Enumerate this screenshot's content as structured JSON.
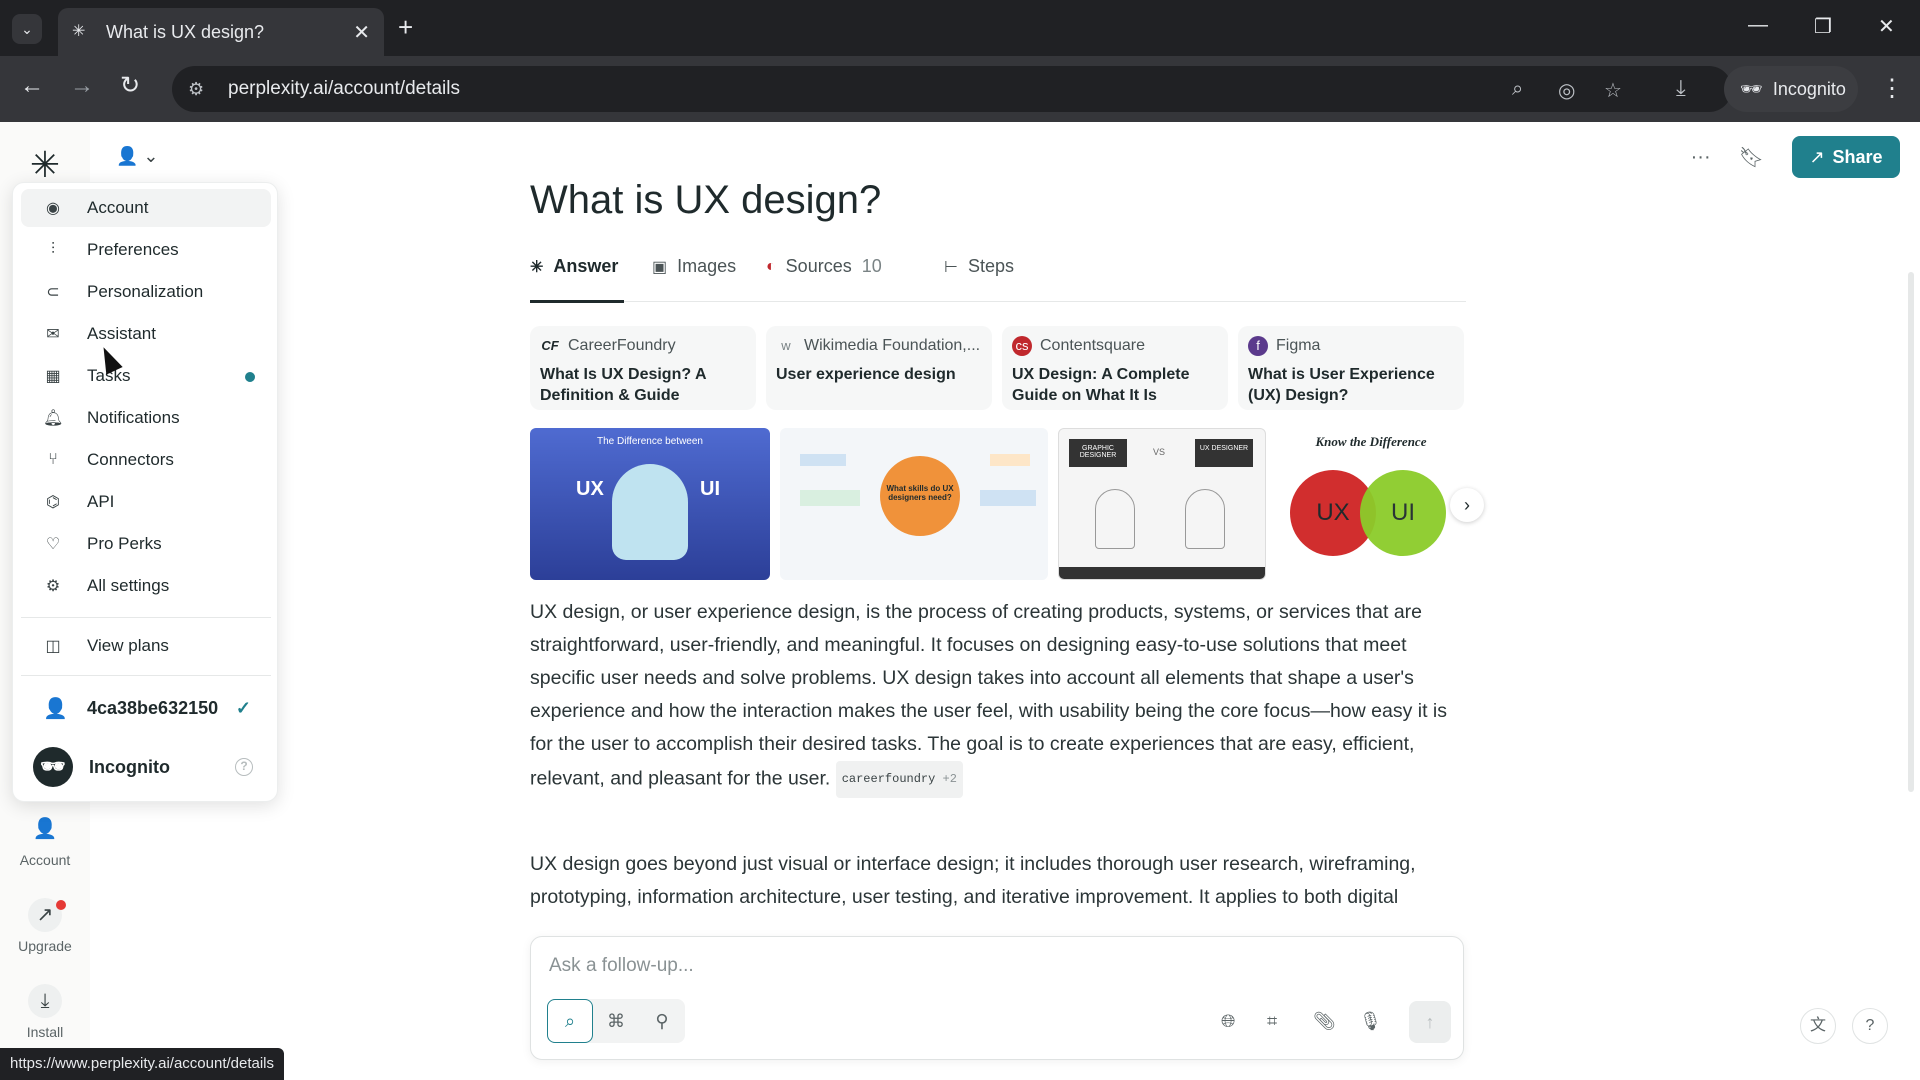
{
  "browser": {
    "tab_title": "What is UX design?",
    "url": "perplexity.ai/account/details",
    "incognito_label": "Incognito",
    "status_url": "https://www.perplexity.ai/account/details"
  },
  "account_menu": {
    "items": [
      {
        "label": "Account",
        "icon": "account-circle-icon"
      },
      {
        "label": "Preferences",
        "icon": "sliders-icon"
      },
      {
        "label": "Personalization",
        "icon": "toggle-icon"
      },
      {
        "label": "Assistant",
        "icon": "mail-icon"
      },
      {
        "label": "Tasks",
        "icon": "calendar-icon"
      },
      {
        "label": "Notifications",
        "icon": "bell-icon"
      },
      {
        "label": "Connectors",
        "icon": "branch-icon"
      },
      {
        "label": "API",
        "icon": "api-icon"
      },
      {
        "label": "Pro Perks",
        "icon": "gift-icon"
      },
      {
        "label": "All settings",
        "icon": "gear-icon"
      }
    ],
    "view_plans": "View plans",
    "user_id": "4ca38be632150",
    "incognito": "Incognito"
  },
  "rail": {
    "account": "Account",
    "upgrade": "Upgrade",
    "install": "Install"
  },
  "header": {
    "share": "Share"
  },
  "thread": {
    "title": "What is UX design?",
    "tabs": {
      "answer": "Answer",
      "images": "Images",
      "sources": "Sources",
      "sources_count": "10",
      "steps": "Steps"
    },
    "sources": [
      {
        "site": "CareerFoundry",
        "title": "What Is UX Design? A Definition & Guide"
      },
      {
        "site": "Wikimedia Foundation,...",
        "title": "User experience design"
      },
      {
        "site": "Contentsquare",
        "title": "UX Design: A Complete Guide on What It Is"
      },
      {
        "site": "Figma",
        "title": "What is User Experience (UX) Design?"
      }
    ],
    "images": [
      {
        "caption": "The Difference between",
        "left": "UX",
        "right": "UI"
      },
      {
        "caption": "What skills do UX designers need?"
      },
      {
        "left": "GRAPHIC DESIGNER",
        "vs": "VS",
        "right": "UX DESIGNER"
      },
      {
        "caption": "Know the Difference",
        "left": "UX",
        "right": "UI"
      }
    ],
    "para1": "UX design, or user experience design, is the process of creating products, systems, or services that are straightforward, user-friendly, and meaningful. It focuses on designing easy-to-use solutions that meet specific user needs and solve problems. UX design takes into account all elements that shape a user's experience and how the interaction makes the user feel, with usability being the core focus—how easy it is for the user to accomplish their desired tasks. The goal is to create experiences that are easy, efficient, relevant, and pleasant for the user.",
    "citation": "careerfoundry",
    "citation_more": "+2",
    "para2": "UX design goes beyond just visual or interface design; it includes thorough user research, wireframing, prototyping, information architecture, user testing, and iterative improvement. It applies to both digital products (such as websites, apps, software) and physical products with"
  },
  "composer": {
    "placeholder": "Ask a follow-up..."
  }
}
